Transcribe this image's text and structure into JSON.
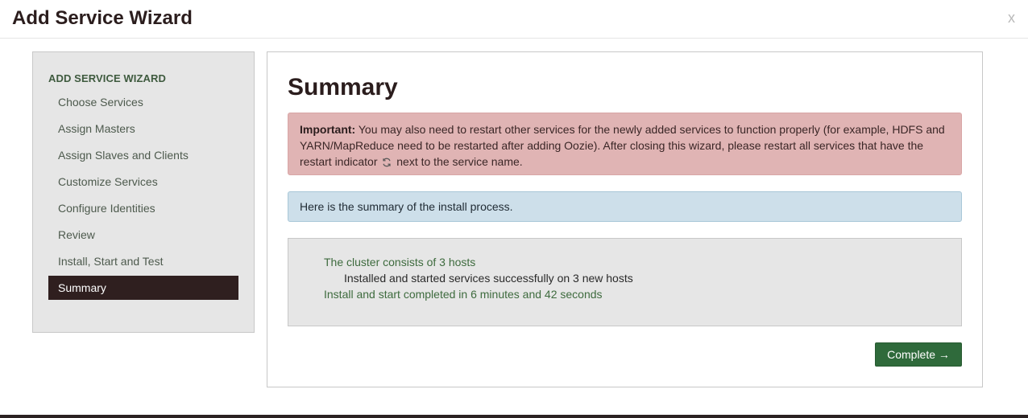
{
  "header": {
    "title": "Add Service Wizard",
    "close_label": "x"
  },
  "sidebar": {
    "heading": "ADD SERVICE WIZARD",
    "items": [
      {
        "label": "Choose Services"
      },
      {
        "label": "Assign Masters"
      },
      {
        "label": "Assign Slaves and Clients"
      },
      {
        "label": "Customize Services"
      },
      {
        "label": "Configure Identities"
      },
      {
        "label": "Review"
      },
      {
        "label": "Install, Start and Test"
      },
      {
        "label": "Summary"
      }
    ],
    "active_item": "Summary"
  },
  "main": {
    "title": "Summary",
    "important_alert": {
      "strong": "Important:",
      "text_before_icon": " You may also need to restart other services for the newly added services to function properly (for example, HDFS and YARN/MapReduce need to be restarted after adding Oozie). After closing this wizard, please restart all services that have the restart indicator",
      "icon": "refresh-icon",
      "text_after_icon": "next to the service name."
    },
    "info_alert": "Here is the summary of the install process.",
    "summary": {
      "line1": "The cluster consists of 3 hosts",
      "line2": "Installed and started services successfully on 3 new hosts",
      "line3": "Install and start completed in 6 minutes and 42 seconds"
    },
    "complete_button": "Complete →"
  },
  "colors": {
    "primary": "#2f6a3b",
    "active_nav": "#2f1f1f",
    "danger_bg": "#e0b4b4",
    "info_bg": "#cddfea"
  }
}
